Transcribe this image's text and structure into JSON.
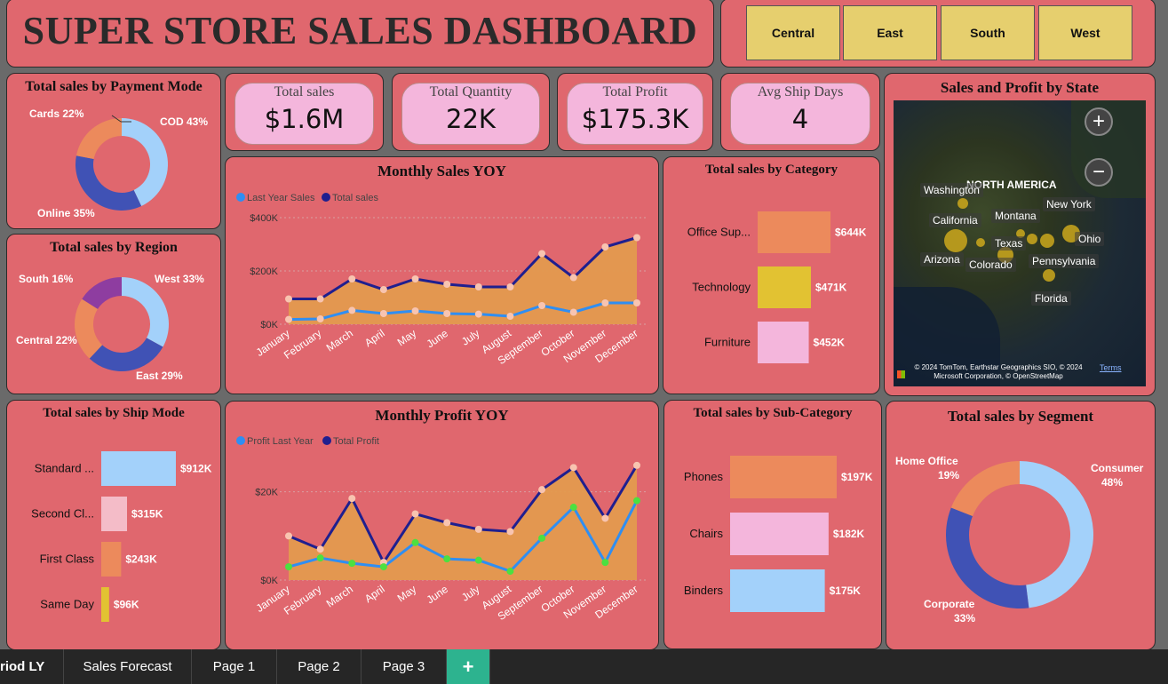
{
  "header": {
    "title": "SUPER STORE SALES DASHBOARD"
  },
  "regions": [
    "Central",
    "East",
    "South",
    "West"
  ],
  "kpis": {
    "total_sales": {
      "label": "Total sales",
      "value": "$1.6M"
    },
    "total_quantity": {
      "label": "Total Quantity",
      "value": "22K"
    },
    "total_profit": {
      "label": "Total Profit",
      "value": "$175.3K"
    },
    "avg_ship_days": {
      "label": "Avg Ship Days",
      "value": "4"
    }
  },
  "colors": {
    "panel": "#e0676e",
    "light_blue": "#a3d1fa",
    "navy": "#4052b5",
    "orange": "#ec8a5c",
    "purple": "#8e3da0",
    "yellow": "#e2c232",
    "pink": "#f4b6dc",
    "line_dark": "#1f1f8f",
    "line_light": "#2f8ef2",
    "area": "#e39a4e"
  },
  "payment_mode": {
    "title": "Total sales by Payment Mode",
    "slices": [
      {
        "name": "COD",
        "pct": 43,
        "label": "COD 43%",
        "color": "#a3d1fa"
      },
      {
        "name": "Online",
        "pct": 35,
        "label": "Online 35%",
        "color": "#4052b5"
      },
      {
        "name": "Cards",
        "pct": 22,
        "label": "Cards 22%",
        "color": "#ec8a5c"
      }
    ]
  },
  "region_chart": {
    "title": "Total sales by Region",
    "slices": [
      {
        "name": "West",
        "pct": 33,
        "label": "West 33%",
        "color": "#a3d1fa"
      },
      {
        "name": "East",
        "pct": 29,
        "label": "East 29%",
        "color": "#4052b5"
      },
      {
        "name": "Central",
        "pct": 22,
        "label": "Central 22%",
        "color": "#ec8a5c"
      },
      {
        "name": "South",
        "pct": 16,
        "label": "South 16%",
        "color": "#8e3da0"
      }
    ]
  },
  "ship_mode": {
    "title": "Total sales by Ship Mode",
    "bars": [
      {
        "label": "Standard ...",
        "value": 912,
        "value_label": "$912K",
        "color": "#a3d1fa"
      },
      {
        "label": "Second Cl...",
        "value": 315,
        "value_label": "$315K",
        "color": "#f4bcc8"
      },
      {
        "label": "First Class",
        "value": 243,
        "value_label": "$243K",
        "color": "#ec8a5c"
      },
      {
        "label": "Same Day",
        "value": 96,
        "value_label": "$96K",
        "color": "#e2c232"
      }
    ]
  },
  "category": {
    "title": "Total sales by Category",
    "bars": [
      {
        "label": "Office Sup...",
        "value": 644,
        "value_label": "$644K",
        "color": "#ec8a5c"
      },
      {
        "label": "Technology",
        "value": 471,
        "value_label": "$471K",
        "color": "#e2c232"
      },
      {
        "label": "Furniture",
        "value": 452,
        "value_label": "$452K",
        "color": "#f4b6dc"
      }
    ]
  },
  "sub_category": {
    "title": "Total sales by Sub-Category",
    "bars": [
      {
        "label": "Phones",
        "value": 197,
        "value_label": "$197K",
        "color": "#ec8a5c"
      },
      {
        "label": "Chairs",
        "value": 182,
        "value_label": "$182K",
        "color": "#f4b6dc"
      },
      {
        "label": "Binders",
        "value": 175,
        "value_label": "$175K",
        "color": "#a3d1fa"
      }
    ]
  },
  "segment": {
    "title": "Total sales by Segment",
    "slices": [
      {
        "name": "Consumer",
        "pct": 48,
        "label": "Consumer 48%",
        "color": "#a3d1fa"
      },
      {
        "name": "Corporate",
        "pct": 33,
        "label": "Corporate 33%",
        "color": "#4052b5"
      },
      {
        "name": "Home Office",
        "pct": 19,
        "label": "Home Office 19%",
        "color": "#ec8a5c"
      }
    ]
  },
  "map": {
    "title": "Sales and Profit by State",
    "continent": "NORTH AMERICA",
    "states": [
      "Washington",
      "California",
      "Montana",
      "New York",
      "Texas",
      "Ohio",
      "Arizona",
      "Colorado",
      "Pennsylvania",
      "Florida"
    ],
    "attribution": "© 2024 TomTom, Earthstar Geographics SIO, © 2024 Microsoft Corporation, © OpenStreetMap",
    "terms": "Terms",
    "zoom_in": "+",
    "zoom_out": "−"
  },
  "chart_data": [
    {
      "type": "line",
      "title": "Monthly Sales YOY",
      "legend": [
        "Last Year Sales",
        "Total sales"
      ],
      "categories": [
        "January",
        "February",
        "March",
        "April",
        "May",
        "June",
        "July",
        "August",
        "September",
        "October",
        "November",
        "December"
      ],
      "series": [
        {
          "name": "Total sales",
          "values": [
            95,
            95,
            170,
            130,
            170,
            150,
            140,
            140,
            265,
            175,
            290,
            325
          ]
        },
        {
          "name": "Last Year Sales",
          "values": [
            18,
            20,
            52,
            40,
            50,
            40,
            38,
            30,
            70,
            45,
            80,
            80
          ]
        }
      ],
      "yticks": [
        "$0K",
        "$200K",
        "$400K"
      ],
      "ylim": [
        0,
        400
      ],
      "unit": "K"
    },
    {
      "type": "line",
      "title": "Monthly Profit YOY",
      "legend": [
        "Profit Last Year",
        "Total Profit"
      ],
      "categories": [
        "January",
        "February",
        "March",
        "April",
        "May",
        "June",
        "July",
        "August",
        "September",
        "October",
        "November",
        "December"
      ],
      "series": [
        {
          "name": "Total Profit",
          "values": [
            10,
            7,
            18.5,
            4,
            15,
            13,
            11.5,
            11,
            20.5,
            25.5,
            14,
            26
          ]
        },
        {
          "name": "Profit Last Year",
          "values": [
            3,
            5,
            3.8,
            3,
            8.5,
            4.8,
            4.5,
            2,
            9.5,
            16.5,
            4,
            18
          ]
        }
      ],
      "yticks": [
        "$0K",
        "$20K"
      ],
      "ylim": [
        0,
        30
      ],
      "unit": "K"
    }
  ],
  "tabs": [
    "riod LY",
    "Sales Forecast",
    "Page 1",
    "Page 2",
    "Page 3",
    "+"
  ]
}
